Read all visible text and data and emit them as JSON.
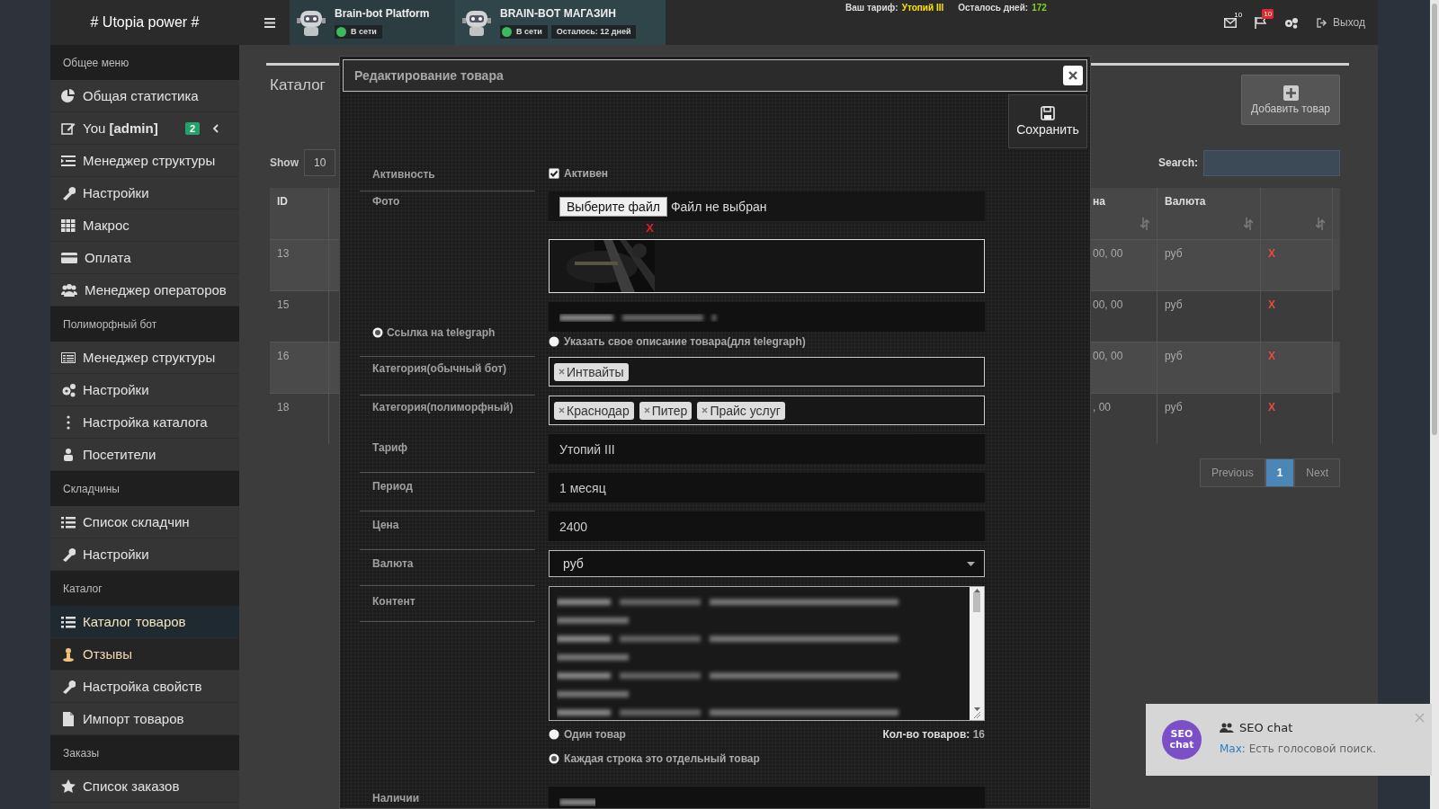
{
  "topbar": {
    "logo": "# Utopia power #",
    "bots": [
      {
        "name": "Brain-bot Platform",
        "status": "В сети",
        "online": true
      },
      {
        "name": "BRAIN-BOT МАГАЗИН",
        "status": "В сети",
        "online": true,
        "remaining": "Осталось: 12 дней"
      }
    ],
    "tariff_label": "Ваш тариф:",
    "tariff": "Утопий III",
    "days_label": "Осталось дней:",
    "days": "172",
    "mail_count": "10",
    "flag_count": "10",
    "logout": "Выход"
  },
  "sidebar": {
    "sections": [
      {
        "title": "Общее меню",
        "items": [
          {
            "label": "Общая статистика",
            "selected": false,
            "hovered": false
          },
          {
            "label": "You **[admin]**",
            "selected": false,
            "hovered": false,
            "badge": "2",
            "kind": "submenu"
          },
          {
            "label": "Менеджер структуры",
            "selected": false,
            "hovered": false
          },
          {
            "label": "Настройки",
            "selected": false,
            "hovered": false
          },
          {
            "label": "Макрос",
            "selected": false,
            "hovered": false
          },
          {
            "label": "Оплата",
            "selected": false,
            "hovered": false
          },
          {
            "label": "Менеджер операторов",
            "selected": false,
            "hovered": false
          }
        ]
      },
      {
        "title": "Полиморфный бот",
        "items": [
          {
            "label": "Менеджер структуры",
            "selected": false,
            "hovered": false
          },
          {
            "label": "Настройки",
            "selected": false,
            "hovered": false
          },
          {
            "label": "Настройка каталога",
            "selected": false,
            "hovered": false
          },
          {
            "label": "Посетители",
            "selected": false,
            "hovered": false
          }
        ]
      },
      {
        "title": "Складчины",
        "items": [
          {
            "label": "Список складчин",
            "selected": false,
            "hovered": false
          },
          {
            "label": "Настройки",
            "selected": false,
            "hovered": false
          }
        ]
      },
      {
        "title": "Каталог",
        "items": [
          {
            "label": "Каталог товаров",
            "selected": true,
            "hovered": false
          },
          {
            "label": "Отзывы",
            "selected": false,
            "hovered": true
          },
          {
            "label": "Настройка свойств",
            "selected": false,
            "hovered": false
          },
          {
            "label": "Импорт товаров",
            "selected": false,
            "hovered": false
          }
        ]
      },
      {
        "title": "Заказы",
        "items": [
          {
            "label": "Список заказов",
            "selected": false,
            "hovered": false
          }
        ]
      }
    ]
  },
  "catalog": {
    "title": "Каталог",
    "add_button": "Добавить товар",
    "show_label": "Show",
    "page_length": "10",
    "search_label": "Search:",
    "columns": [
      "ID",
      "на",
      "Валюта"
    ],
    "rows": [
      {
        "id": "13",
        "column_2": "00, 00",
        "currency": "руб",
        "delete": "X"
      },
      {
        "id": "15",
        "column_2": "00, 00",
        "currency": "руб",
        "delete": "X"
      },
      {
        "id": "16",
        "column_2": "00, 00",
        "currency": "руб",
        "delete": "X"
      },
      {
        "id": "18",
        "column_2": ", 00",
        "currency": "руб",
        "delete": "X"
      }
    ],
    "pagination": [
      {
        "label": "Previous",
        "selected": false
      },
      {
        "label": "1",
        "selected": true
      },
      {
        "label": "Next",
        "selected": false
      }
    ]
  },
  "modal": {
    "title": "Редактирование товара",
    "save_button": "Сохранить",
    "fields": [
      {
        "kind": "checkbox",
        "label": "Активность",
        "option": "Активен",
        "checked": true
      },
      {
        "kind": "file",
        "label": "Фото",
        "button": "Выберите файл",
        "status": "Файл не выбран",
        "remove": "X"
      },
      {
        "kind": "telegraph",
        "options": [
          {
            "label": "Ссылка на telegraph",
            "selected": true
          },
          {
            "label": "Указать свое описание товара(для telegraph)",
            "selected": false
          }
        ]
      },
      {
        "kind": "tags",
        "label": "Категория(обычный бот)",
        "tags": [
          "Интвайты"
        ]
      },
      {
        "kind": "tags",
        "label": "Категория(полиморфный)",
        "tags": [
          "Краснодар",
          "Питер",
          "Прайс услуг"
        ]
      },
      {
        "kind": "text",
        "label": "Тариф",
        "value": "Утопий III"
      },
      {
        "kind": "text",
        "label": "Период",
        "value": "1 месяц"
      },
      {
        "kind": "text",
        "label": "Цена",
        "value": "2400"
      },
      {
        "kind": "select",
        "label": "Валюта",
        "value": "руб"
      },
      {
        "kind": "content",
        "label": "Контент",
        "options": [
          {
            "label": "Один товар",
            "selected": false
          },
          {
            "label": "Каждая строка это отдельный товар",
            "selected": true
          }
        ],
        "count_label": "Кол-во товаров:",
        "count": "16"
      },
      {
        "kind": "blurred",
        "label": "Наличии"
      }
    ]
  },
  "chat": {
    "logo": "SEO chat",
    "title": "SEO chat",
    "sender": "Max:",
    "message": "Есть голосовой поиск."
  }
}
